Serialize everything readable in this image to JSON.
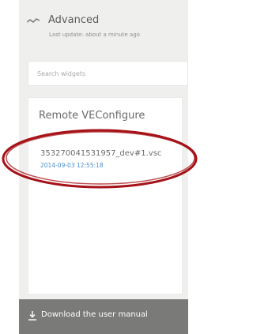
{
  "header": {
    "icon": "trend-line-icon",
    "title": "Advanced",
    "subtitle": "Last update: about a minute ago"
  },
  "search": {
    "placeholder": "Search widgets",
    "value": ""
  },
  "widget": {
    "title": "Remote VEConfigure",
    "file": {
      "name": "353270041531957_dev#1.vsc",
      "date": "2014-09-03 12:55:18"
    }
  },
  "footer": {
    "icon": "download-icon",
    "download_label": "Download the user manual"
  },
  "colors": {
    "panel_bg": "#efefed",
    "link_blue": "#4a8fd0",
    "footer_bg": "#7a7a78",
    "highlight_red": "#a51218"
  }
}
